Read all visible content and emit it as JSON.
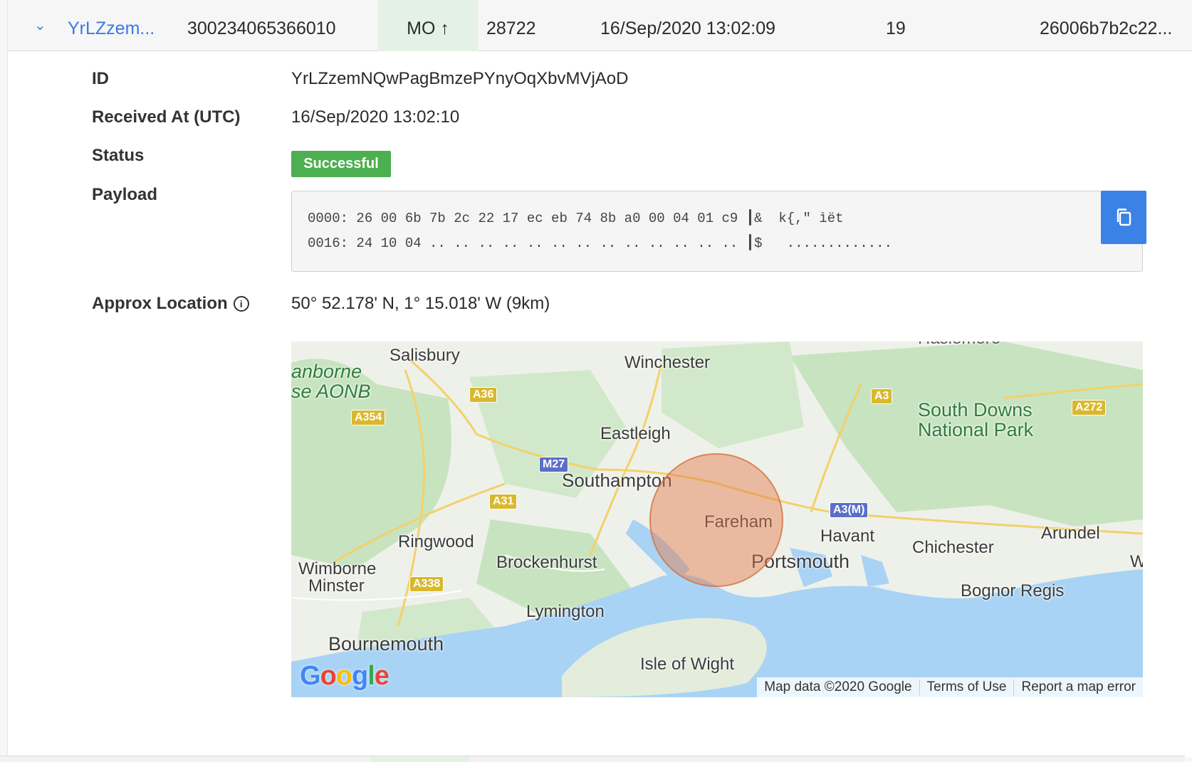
{
  "row": {
    "id_short": "YrLZzem...",
    "imei": "300234065366010",
    "direction": "MO ↑",
    "number": "28722",
    "date": "16/Sep/2020 13:02:09",
    "count": "19",
    "hash": "26006b7b2c22..."
  },
  "details": {
    "id_label": "ID",
    "id_value": "YrLZzemNQwPagBmzePYnyOqXbvMVjAoD",
    "received_label": "Received At (UTC)",
    "received_value": "16/Sep/2020 13:02:10",
    "status_label": "Status",
    "status_value": "Successful",
    "payload_label": "Payload",
    "payload_line1": "0000: 26 00 6b 7b 2c 22 17 ec eb 74 8b a0 00 04 01 c9 ┃&  k{,\" ìët",
    "payload_line2": "0016: 24 10 04 .. .. .. .. .. .. .. .. .. .. .. .. .. ┃$   .............",
    "location_label": "Approx Location",
    "location_value": "50° 52.178' N,    1° 15.018' W (9km)"
  },
  "map": {
    "places": {
      "salisbury": "Salisbury",
      "cranborne": "anborne",
      "aonb": "se AONB",
      "winchester": "Winchester",
      "haslemere": "Haslemere",
      "south_downs": "South Downs",
      "national_park": "National Park",
      "eastleigh": "Eastleigh",
      "southampton": "Southampton",
      "fareham": "Fareham",
      "havant": "Havant",
      "chichester": "Chichester",
      "arundel": "Arundel",
      "ringwood": "Ringwood",
      "brockenhurst": "Brockenhurst",
      "portsmouth": "Portsmouth",
      "bognor": "Bognor Regis",
      "wimborne": "Wimborne",
      "minster": "Minster",
      "lymington": "Lymington",
      "bournemouth": "Bournemouth",
      "isle_of_wight": "Isle of Wight",
      "w": "W"
    },
    "roads": {
      "a36": "A36",
      "a354": "A354",
      "m27": "M27",
      "a31": "A31",
      "a338": "A338",
      "a3": "A3",
      "a272": "A272",
      "a3m": "A3(M)"
    },
    "logo": "Google",
    "attribution": [
      "Map data ©2020 Google",
      "Terms of Use",
      "Report a map error"
    ],
    "colors": {
      "land": "#e9efe2",
      "green": "#c8e3c0",
      "water": "#a9d3f5",
      "circle": "#e27846"
    }
  },
  "colors": {
    "link": "#3a78e6",
    "success": "#4caf50",
    "copy_button": "#3b82e6",
    "mo_cell": "#e3f2e4"
  }
}
